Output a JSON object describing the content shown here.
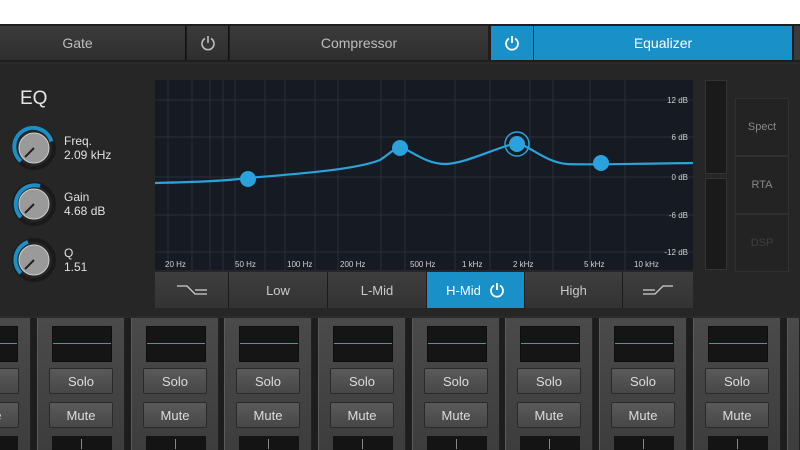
{
  "tabs": {
    "gate": "Gate",
    "compressor": "Compressor",
    "equalizer": "Equalizer"
  },
  "eq": {
    "title": "EQ",
    "knobs": [
      {
        "label": "Freq.",
        "value": "2.09 kHz",
        "level": 0.62
      },
      {
        "label": "Gain",
        "value": "4.68 dB",
        "level": 0.56
      },
      {
        "label": "Q",
        "value": "1.51",
        "level": 0.45
      }
    ],
    "db_labels": [
      "12 dB",
      "6 dB",
      "0 dB",
      "-6 dB",
      "-12 dB"
    ],
    "freq_labels": [
      "20 Hz",
      "50 Hz",
      "100 Hz",
      "200 Hz",
      "500 Hz",
      "1 kHz",
      "2 kHz",
      "5 kHz",
      "10 kHz"
    ],
    "bands": {
      "low_shelf_icon": "low-shelf-icon",
      "low": "Low",
      "lmid": "L-Mid",
      "hmid": "H-Mid",
      "high": "High",
      "high_shelf_icon": "high-shelf-icon"
    },
    "side_buttons": {
      "spect": "Spect",
      "rta": "RTA",
      "dsp": "DSP"
    },
    "accent": "#1a90c9",
    "curve_color": "#2aa3dc"
  },
  "channels": {
    "solo": "Solo",
    "mute": "Mute",
    "meter_color": "#2fa595"
  }
}
